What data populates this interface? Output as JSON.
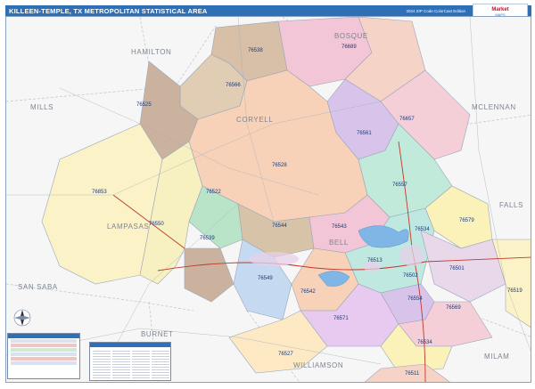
{
  "header": {
    "title": "KILLEEN-TEMPLE, TX METROPOLITAN STATISTICAL AREA",
    "edition": "2024 ZIP Code ColorCast Edition",
    "logo_line1": "Market",
    "logo_line2": "MAPS"
  },
  "counties": [
    {
      "name": "HAMILTON"
    },
    {
      "name": "BOSQUE"
    },
    {
      "name": "MCLENNAN"
    },
    {
      "name": "MILLS"
    },
    {
      "name": "CORYELL"
    },
    {
      "name": "FALLS"
    },
    {
      "name": "LAMPASAS"
    },
    {
      "name": "BELL"
    },
    {
      "name": "SAN SABA"
    },
    {
      "name": "BURNET"
    },
    {
      "name": "MILAM"
    },
    {
      "name": "WILLIAMSON"
    }
  ],
  "zips": [
    "76538",
    "76689",
    "76566",
    "76525",
    "76657",
    "76561",
    "76528",
    "76853",
    "76522",
    "76557",
    "76550",
    "76579",
    "76544",
    "76543",
    "76539",
    "76534",
    "76513",
    "76501",
    "76549",
    "76542",
    "76502",
    "76519",
    "76554",
    "76569",
    "76571",
    "76534",
    "76527",
    "76511"
  ],
  "colors": {
    "header_bg": "#2f6fb6",
    "background": "#f6f6f6",
    "water": "#7fb6e6",
    "zip_label": "#1f3b73",
    "county_label": "#7d8591"
  },
  "legend": {
    "icons": [
      "compass-icon"
    ]
  }
}
